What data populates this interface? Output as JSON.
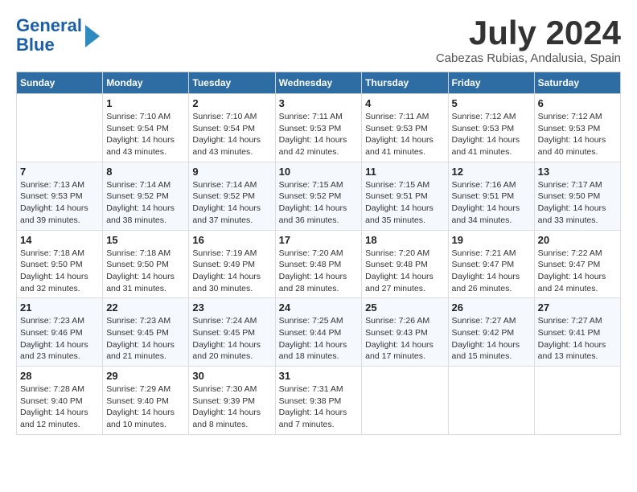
{
  "logo": {
    "line1": "General",
    "line2": "Blue"
  },
  "title": "July 2024",
  "subtitle": "Cabezas Rubias, Andalusia, Spain",
  "weekdays": [
    "Sunday",
    "Monday",
    "Tuesday",
    "Wednesday",
    "Thursday",
    "Friday",
    "Saturday"
  ],
  "weeks": [
    [
      {
        "day": "",
        "text": ""
      },
      {
        "day": "1",
        "text": "Sunrise: 7:10 AM\nSunset: 9:54 PM\nDaylight: 14 hours\nand 43 minutes."
      },
      {
        "day": "2",
        "text": "Sunrise: 7:10 AM\nSunset: 9:54 PM\nDaylight: 14 hours\nand 43 minutes."
      },
      {
        "day": "3",
        "text": "Sunrise: 7:11 AM\nSunset: 9:53 PM\nDaylight: 14 hours\nand 42 minutes."
      },
      {
        "day": "4",
        "text": "Sunrise: 7:11 AM\nSunset: 9:53 PM\nDaylight: 14 hours\nand 41 minutes."
      },
      {
        "day": "5",
        "text": "Sunrise: 7:12 AM\nSunset: 9:53 PM\nDaylight: 14 hours\nand 41 minutes."
      },
      {
        "day": "6",
        "text": "Sunrise: 7:12 AM\nSunset: 9:53 PM\nDaylight: 14 hours\nand 40 minutes."
      }
    ],
    [
      {
        "day": "7",
        "text": "Sunrise: 7:13 AM\nSunset: 9:53 PM\nDaylight: 14 hours\nand 39 minutes."
      },
      {
        "day": "8",
        "text": "Sunrise: 7:14 AM\nSunset: 9:52 PM\nDaylight: 14 hours\nand 38 minutes."
      },
      {
        "day": "9",
        "text": "Sunrise: 7:14 AM\nSunset: 9:52 PM\nDaylight: 14 hours\nand 37 minutes."
      },
      {
        "day": "10",
        "text": "Sunrise: 7:15 AM\nSunset: 9:52 PM\nDaylight: 14 hours\nand 36 minutes."
      },
      {
        "day": "11",
        "text": "Sunrise: 7:15 AM\nSunset: 9:51 PM\nDaylight: 14 hours\nand 35 minutes."
      },
      {
        "day": "12",
        "text": "Sunrise: 7:16 AM\nSunset: 9:51 PM\nDaylight: 14 hours\nand 34 minutes."
      },
      {
        "day": "13",
        "text": "Sunrise: 7:17 AM\nSunset: 9:50 PM\nDaylight: 14 hours\nand 33 minutes."
      }
    ],
    [
      {
        "day": "14",
        "text": "Sunrise: 7:18 AM\nSunset: 9:50 PM\nDaylight: 14 hours\nand 32 minutes."
      },
      {
        "day": "15",
        "text": "Sunrise: 7:18 AM\nSunset: 9:50 PM\nDaylight: 14 hours\nand 31 minutes."
      },
      {
        "day": "16",
        "text": "Sunrise: 7:19 AM\nSunset: 9:49 PM\nDaylight: 14 hours\nand 30 minutes."
      },
      {
        "day": "17",
        "text": "Sunrise: 7:20 AM\nSunset: 9:48 PM\nDaylight: 14 hours\nand 28 minutes."
      },
      {
        "day": "18",
        "text": "Sunrise: 7:20 AM\nSunset: 9:48 PM\nDaylight: 14 hours\nand 27 minutes."
      },
      {
        "day": "19",
        "text": "Sunrise: 7:21 AM\nSunset: 9:47 PM\nDaylight: 14 hours\nand 26 minutes."
      },
      {
        "day": "20",
        "text": "Sunrise: 7:22 AM\nSunset: 9:47 PM\nDaylight: 14 hours\nand 24 minutes."
      }
    ],
    [
      {
        "day": "21",
        "text": "Sunrise: 7:23 AM\nSunset: 9:46 PM\nDaylight: 14 hours\nand 23 minutes."
      },
      {
        "day": "22",
        "text": "Sunrise: 7:23 AM\nSunset: 9:45 PM\nDaylight: 14 hours\nand 21 minutes."
      },
      {
        "day": "23",
        "text": "Sunrise: 7:24 AM\nSunset: 9:45 PM\nDaylight: 14 hours\nand 20 minutes."
      },
      {
        "day": "24",
        "text": "Sunrise: 7:25 AM\nSunset: 9:44 PM\nDaylight: 14 hours\nand 18 minutes."
      },
      {
        "day": "25",
        "text": "Sunrise: 7:26 AM\nSunset: 9:43 PM\nDaylight: 14 hours\nand 17 minutes."
      },
      {
        "day": "26",
        "text": "Sunrise: 7:27 AM\nSunset: 9:42 PM\nDaylight: 14 hours\nand 15 minutes."
      },
      {
        "day": "27",
        "text": "Sunrise: 7:27 AM\nSunset: 9:41 PM\nDaylight: 14 hours\nand 13 minutes."
      }
    ],
    [
      {
        "day": "28",
        "text": "Sunrise: 7:28 AM\nSunset: 9:40 PM\nDaylight: 14 hours\nand 12 minutes."
      },
      {
        "day": "29",
        "text": "Sunrise: 7:29 AM\nSunset: 9:40 PM\nDaylight: 14 hours\nand 10 minutes."
      },
      {
        "day": "30",
        "text": "Sunrise: 7:30 AM\nSunset: 9:39 PM\nDaylight: 14 hours\nand 8 minutes."
      },
      {
        "day": "31",
        "text": "Sunrise: 7:31 AM\nSunset: 9:38 PM\nDaylight: 14 hours\nand 7 minutes."
      },
      {
        "day": "",
        "text": ""
      },
      {
        "day": "",
        "text": ""
      },
      {
        "day": "",
        "text": ""
      }
    ]
  ]
}
